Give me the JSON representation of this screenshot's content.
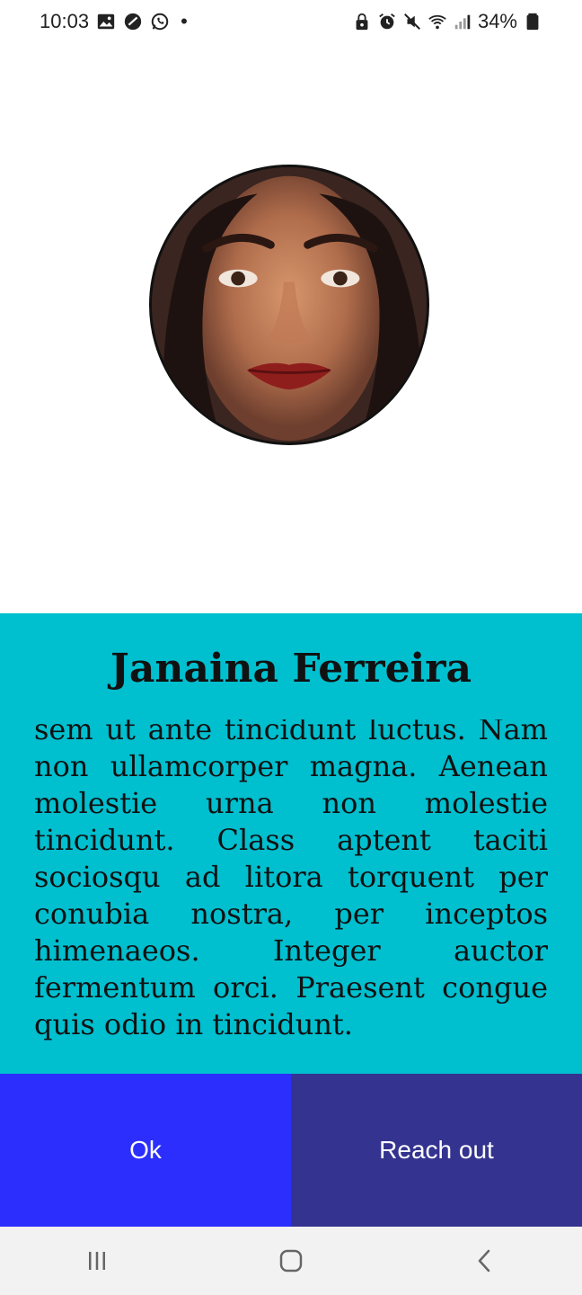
{
  "status_bar": {
    "time": "10:03",
    "battery": "34%",
    "left_icons": [
      "gallery-icon",
      "blocked-icon",
      "whatsapp-icon"
    ],
    "right_icons": [
      "lock-icon",
      "alarm-icon",
      "mute-icon",
      "wifi-icon",
      "signal-icon",
      "battery-icon"
    ]
  },
  "profile": {
    "name": "Janaina Ferreira",
    "bio": "sem ut ante tincidunt luctus. Nam non ullamcorper magna. Aenean molestie urna non molestie tincidunt. Class aptent taciti sociosqu ad litora torquent per conubia nostra, per inceptos himenaeos. Integer auctor fermentum orci. Praesent congue quis odio in tincidunt."
  },
  "actions": {
    "ok_label": "Ok",
    "reach_label": "Reach out"
  },
  "colors": {
    "card": "#00bfcf",
    "ok_button": "#2b2efc",
    "reach_button": "#34338f"
  },
  "nav_bar": {
    "icons": [
      "recents-icon",
      "home-icon",
      "back-icon"
    ]
  }
}
